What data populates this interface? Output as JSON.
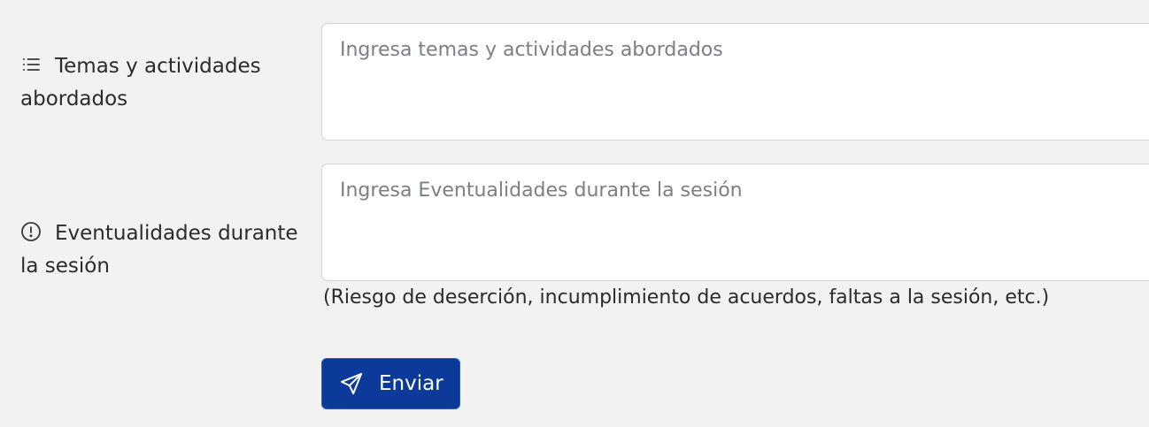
{
  "form": {
    "temas": {
      "label": "Temas y actividades abordados",
      "icon": "list-icon",
      "placeholder": "Ingresa temas y actividades abordados",
      "value": ""
    },
    "eventualidades": {
      "label": "Eventualidades durante la sesión",
      "icon": "exclamation-circle-icon",
      "placeholder": "Ingresa Eventualidades durante la sesión",
      "value": "",
      "hint": "(Riesgo de deserción, incumplimiento de acuerdos, faltas a la sesión, etc.)"
    },
    "submit": {
      "label": "Enviar",
      "icon": "send-icon"
    }
  },
  "colors": {
    "background": "#f2f2f2",
    "primary_button": "#0b3a9a",
    "field_border": "#cfd3d8",
    "placeholder": "#7a7f86"
  }
}
